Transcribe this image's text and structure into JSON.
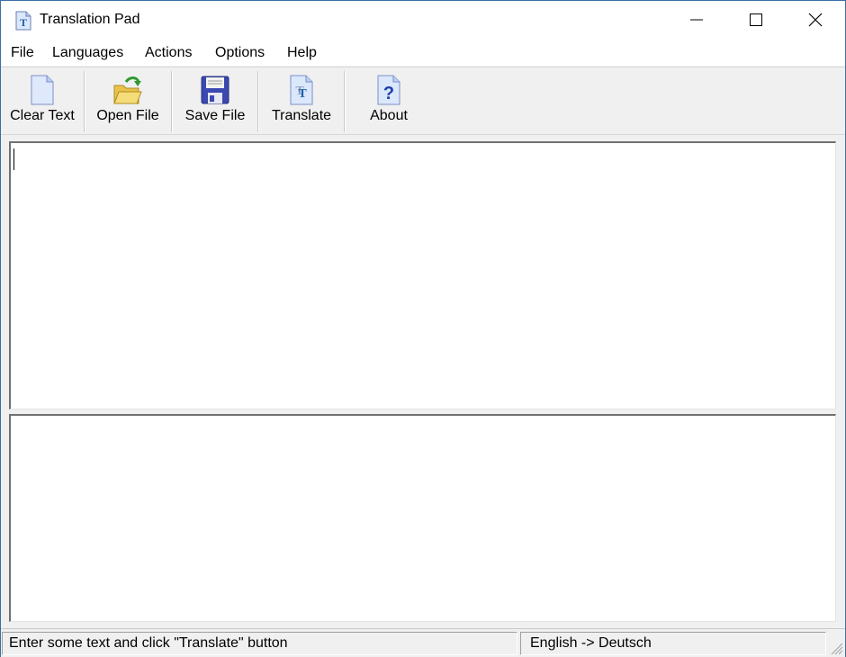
{
  "window": {
    "title": "Translation Pad",
    "icon": "translation-pad-app-icon",
    "controls": [
      "minimize",
      "maximize",
      "close"
    ]
  },
  "menu": [
    {
      "label": "File"
    },
    {
      "label": "Languages"
    },
    {
      "label": "Actions"
    },
    {
      "label": "Options"
    },
    {
      "label": "Help"
    }
  ],
  "toolbar": [
    {
      "label": "Clear Text",
      "icon": "blank-page-icon"
    },
    {
      "label": "Open File",
      "icon": "open-folder-icon"
    },
    {
      "label": "Save File",
      "icon": "floppy-disk-icon"
    },
    {
      "label": "Translate",
      "icon": "translate-document-icon"
    },
    {
      "label": "About",
      "icon": "help-document-icon"
    }
  ],
  "editor": {
    "source_text": "",
    "translated_text": ""
  },
  "status": {
    "message": "Enter some text and click \"Translate\" button",
    "language_pair": "English -> Deutsch"
  },
  "colors": {
    "window_border": "#3a6ea5",
    "background": "#f0f0f0",
    "icon_blue": "#3050b0"
  }
}
